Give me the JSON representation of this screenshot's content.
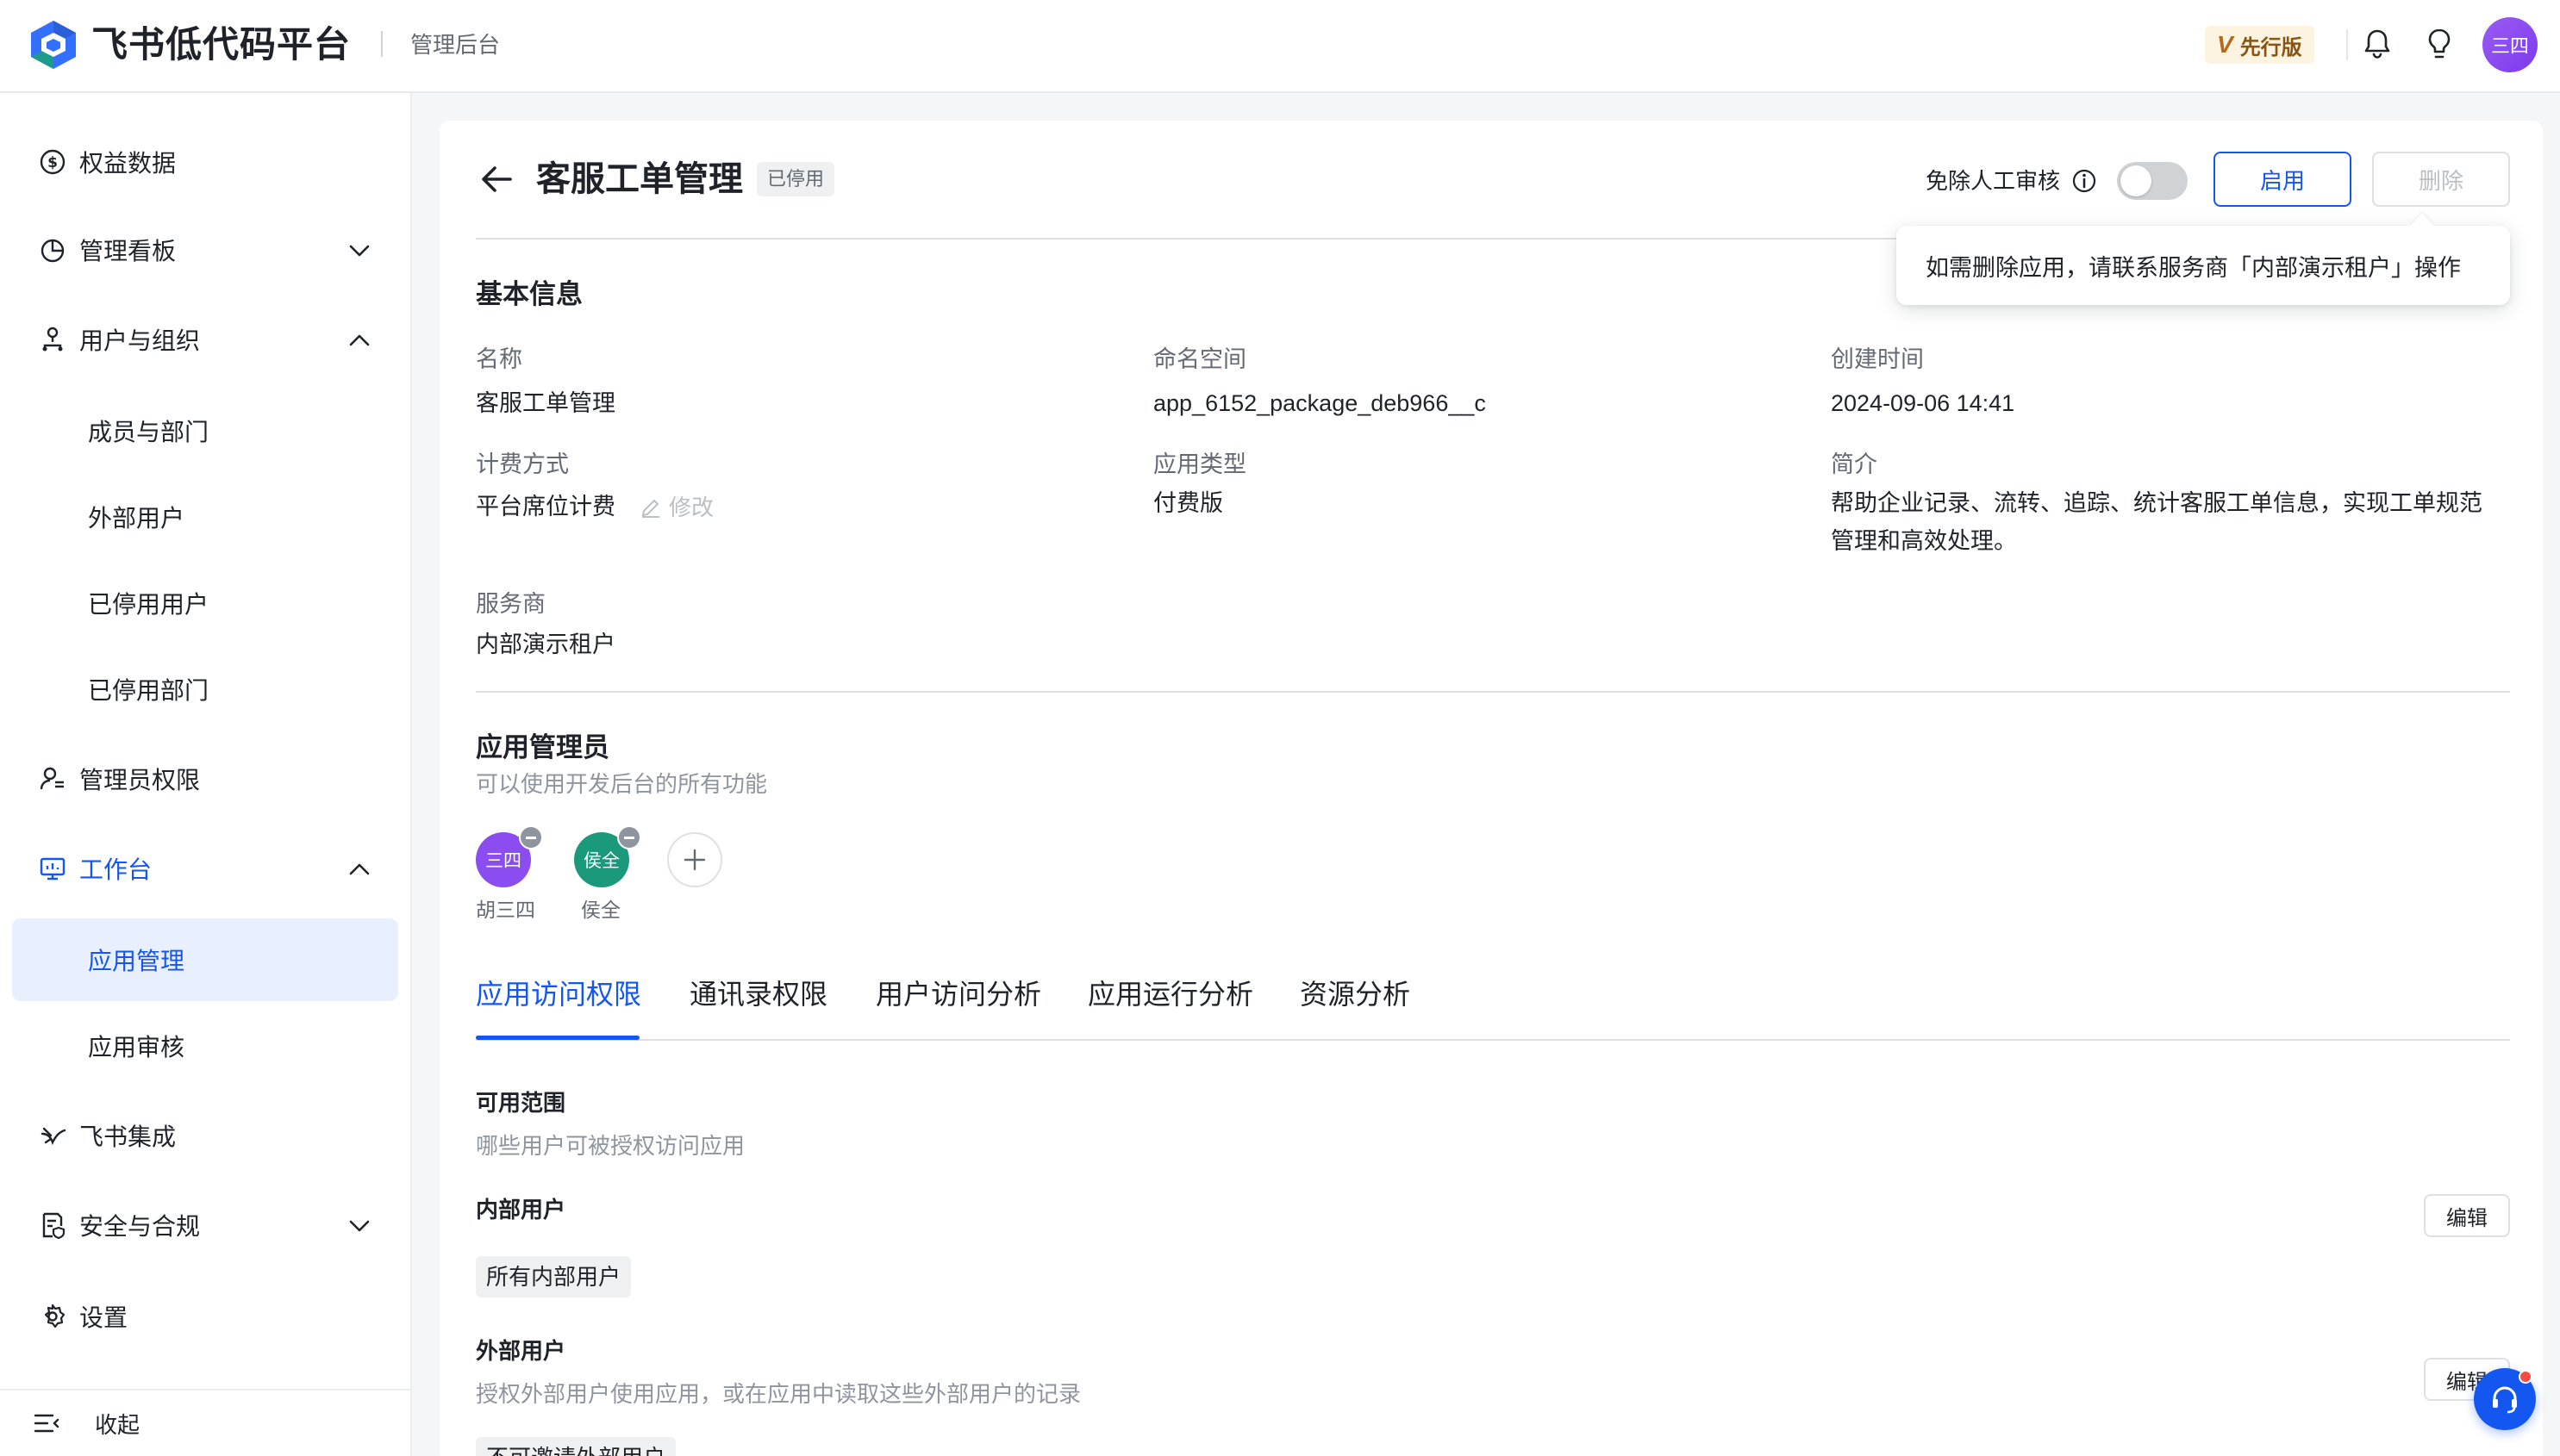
{
  "header": {
    "brand": "飞书低代码平台",
    "subtitle": "管理后台",
    "edition_badge": {
      "v": "V",
      "label": "先行版"
    },
    "user_avatar": "三四",
    "icons": [
      "bell-icon",
      "lightbulb-icon"
    ]
  },
  "sidebar": {
    "items": [
      {
        "label": "权益数据",
        "icon": "dollar-circle-icon"
      },
      {
        "label": "管理看板",
        "icon": "pie-chart-icon",
        "expanded": false
      },
      {
        "label": "用户与组织",
        "icon": "org-tree-icon",
        "expanded": true
      },
      {
        "label": "成员与部门"
      },
      {
        "label": "外部用户"
      },
      {
        "label": "已停用用户"
      },
      {
        "label": "已停用部门"
      },
      {
        "label": "管理员权限",
        "icon": "admin-user-icon"
      },
      {
        "label": "工作台",
        "icon": "monitor-icon",
        "expanded": true
      },
      {
        "label": "应用管理",
        "active": true
      },
      {
        "label": "应用审核"
      },
      {
        "label": "飞书集成",
        "icon": "integration-icon"
      },
      {
        "label": "安全与合规",
        "icon": "security-doc-icon",
        "expanded": false
      },
      {
        "label": "设置",
        "icon": "gear-icon"
      }
    ],
    "collapse_label": "收起"
  },
  "app": {
    "title": "客服工单管理",
    "status": "已停用",
    "review_exempt_label": "免除人工审核",
    "review_exempt_on": false,
    "enable_button": "启用",
    "delete_button": "删除",
    "delete_tooltip": "如需删除应用，请联系服务商「内部演示租户」操作"
  },
  "basic_info": {
    "title": "基本信息",
    "name_label": "名称",
    "name_value": "客服工单管理",
    "namespace_label": "命名空间",
    "namespace_value": "app_6152_package_deb966__c",
    "created_label": "创建时间",
    "created_value": "2024-09-06 14:41",
    "billing_label": "计费方式",
    "billing_value": "平台席位计费",
    "billing_edit": "修改",
    "type_label": "应用类型",
    "type_value": "付费版",
    "intro_label": "简介",
    "intro_line1": "帮助企业记录、流转、追踪、统计客服工单信息，实现工单规范",
    "intro_line2": "管理和高效处理。",
    "provider_label": "服务商",
    "provider_value": "内部演示租户"
  },
  "admins": {
    "title": "应用管理员",
    "description": "可以使用开发后台的所有功能",
    "list": [
      {
        "avatar_text": "三四",
        "name": "胡三四",
        "color": "#8b4cf0"
      },
      {
        "avatar_text": "侯全",
        "name": "侯全",
        "color": "#1a9a7a"
      }
    ]
  },
  "tabs": [
    "应用访问权限",
    "通讯录权限",
    "用户访问分析",
    "应用运行分析",
    "资源分析"
  ],
  "access": {
    "scope_title": "可用范围",
    "scope_desc": "哪些用户可被授权访问应用",
    "internal_title": "内部用户",
    "internal_chip": "所有内部用户",
    "edit_label": "编辑",
    "external_title": "外部用户",
    "external_desc": "授权外部用户使用应用，或在应用中读取这些外部用户的记录",
    "external_chip": "不可邀请外部用户",
    "external_edit_label": "编辑"
  },
  "colors": {
    "accent": "#1456f0",
    "active_bg": "#e8efff",
    "text": "#1f2329",
    "muted": "#646a73"
  }
}
